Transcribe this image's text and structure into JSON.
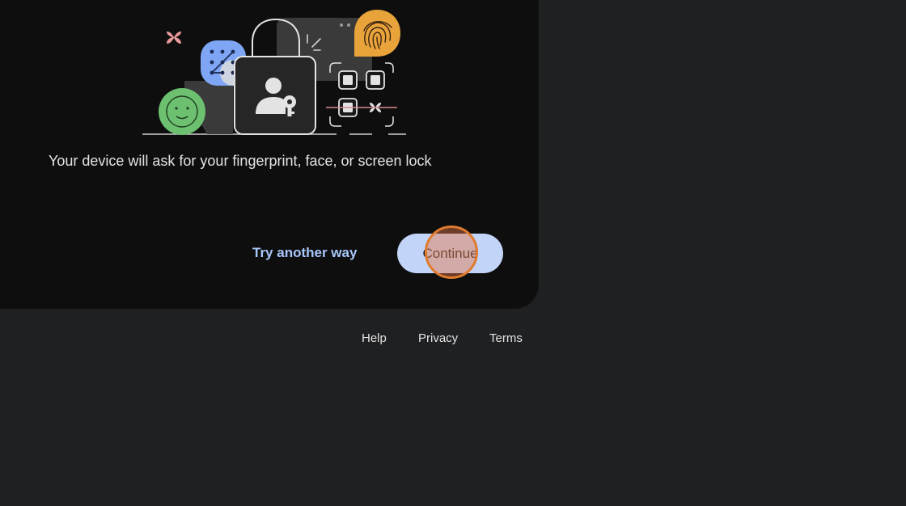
{
  "main": {
    "message": "Your device will ask for your fingerprint, face, or screen lock",
    "actions": {
      "try_another_label": "Try another way",
      "continue_label": "Continue"
    }
  },
  "footer": {
    "links": [
      "Help",
      "Privacy",
      "Terms"
    ]
  },
  "icons": {
    "fingerprint": "fingerprint-icon",
    "padlock": "padlock-icon",
    "face": "smiley-face-icon",
    "pattern": "pattern-lock-icon",
    "qr": "qr-scan-icon"
  },
  "colors": {
    "page_bg": "#1f2022",
    "card_bg": "#0e0e0e",
    "primary_button": "#c2d5f8",
    "link": "#a8c7fa",
    "fingerprint": "#e8a33a",
    "face": "#6cc070",
    "pattern": "#7ea6f5",
    "sparkle": "#e89a9a",
    "click_indicator": "#e07a2e"
  }
}
